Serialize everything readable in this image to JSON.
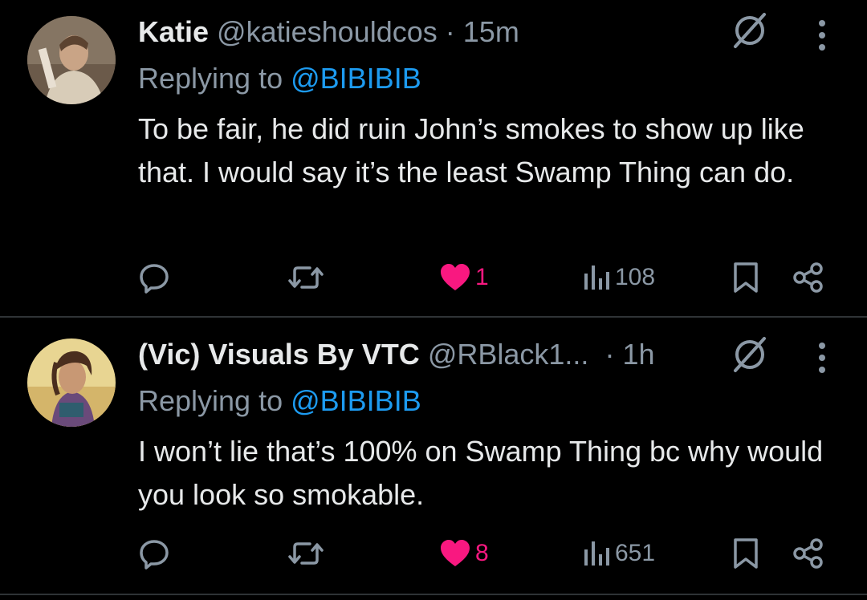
{
  "tweets": [
    {
      "name": "Katie",
      "handle": "@katieshouldcos",
      "dot": "·",
      "time": "15m",
      "replying_prefix": "Replying to ",
      "replying_to": "@BIBIBIB",
      "text": "To be fair, he did ruin John’s smokes to show up like that. I would say it’s the least Swamp Thing can do.",
      "likes": "1",
      "views": "108",
      "liked": true
    },
    {
      "name": "(Vic) Visuals By VTC",
      "handle": "@RBlack1...",
      "dot": "·",
      "time": "1h",
      "replying_prefix": "Replying to ",
      "replying_to": "@BIBIBIB",
      "text": "I won’t lie that’s 100% on Swamp Thing bc why would you look so smokable.",
      "likes": "8",
      "views": "651",
      "liked": true
    }
  ],
  "icons": {
    "reply": "reply-icon",
    "retweet": "retweet-icon",
    "like": "heart-icon",
    "views": "views-icon",
    "bookmark": "bookmark-icon",
    "share": "share-icon",
    "grok": "grok-icon",
    "more": "more-vertical-icon"
  },
  "colors": {
    "background": "#000000",
    "text": "#e7e9ea",
    "secondary": "#8b98a5",
    "link": "#1d9bf0",
    "like": "#f91880",
    "divider": "#2f3336"
  }
}
